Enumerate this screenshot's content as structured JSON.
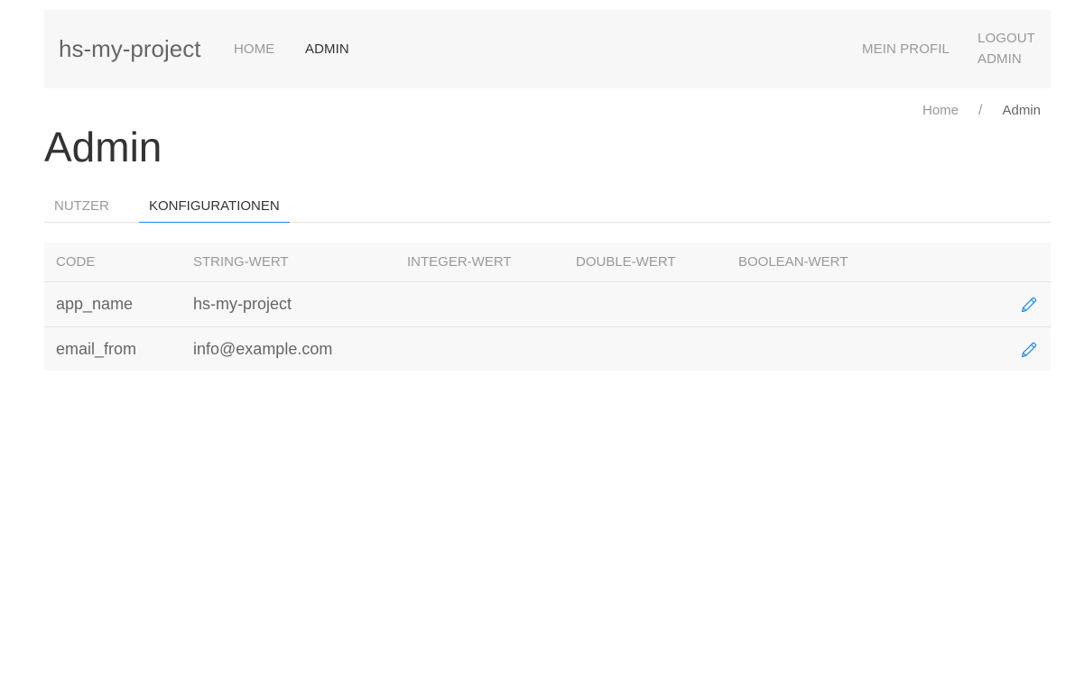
{
  "navbar": {
    "brand": "hs-my-project",
    "links": [
      {
        "label": "Home",
        "active": false
      },
      {
        "label": "Admin",
        "active": true
      }
    ],
    "profile_label": "Mein Profil",
    "logout_line1": "Logout",
    "logout_line2": "admin"
  },
  "breadcrumb": {
    "home": "Home",
    "separator": "/",
    "current": "Admin"
  },
  "page": {
    "title": "Admin"
  },
  "tabs": [
    {
      "label": "Nutzer",
      "active": false
    },
    {
      "label": "Konfigurationen",
      "active": true
    }
  ],
  "table": {
    "headers": [
      "Code",
      "String-Wert",
      "Integer-Wert",
      "Double-Wert",
      "Boolean-Wert"
    ],
    "rows": [
      {
        "code": "app_name",
        "string": "hs-my-project",
        "integer": "",
        "double": "",
        "boolean": ""
      },
      {
        "code": "email_from",
        "string": "info@example.com",
        "integer": "",
        "double": "",
        "boolean": ""
      }
    ],
    "edit_icon": "pencil-icon"
  },
  "colors": {
    "accent": "#1e87f0",
    "navbar_bg": "#f7f7f7",
    "table_bg": "#f8f8f8",
    "muted_text": "#999999"
  }
}
